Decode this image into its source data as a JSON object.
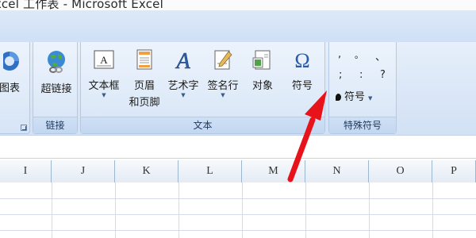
{
  "window": {
    "title": "xcel 工作表 - Microsoft Excel"
  },
  "ribbon": {
    "illustrations": {
      "chart_label": "图表"
    },
    "links": {
      "hyperlink_label": "超链接",
      "group_label": "链接"
    },
    "text": {
      "textbox_label": "文本框",
      "header_footer_label_1": "页眉",
      "header_footer_label_2": "和页脚",
      "wordart_label": "艺术字",
      "signature_label": "签名行",
      "object_label": "对象",
      "symbol_label": "符号",
      "group_label": "文本"
    },
    "special_symbols": {
      "row1": [
        ",",
        "。",
        "、"
      ],
      "row2": [
        ";",
        ":",
        "?"
      ],
      "button_label": "符号",
      "group_label": "特殊符号"
    }
  },
  "sheet": {
    "columns": [
      "I",
      "J",
      "K",
      "L",
      "M",
      "N",
      "O",
      "P"
    ]
  },
  "annotation": {
    "color": "#e8121b"
  }
}
